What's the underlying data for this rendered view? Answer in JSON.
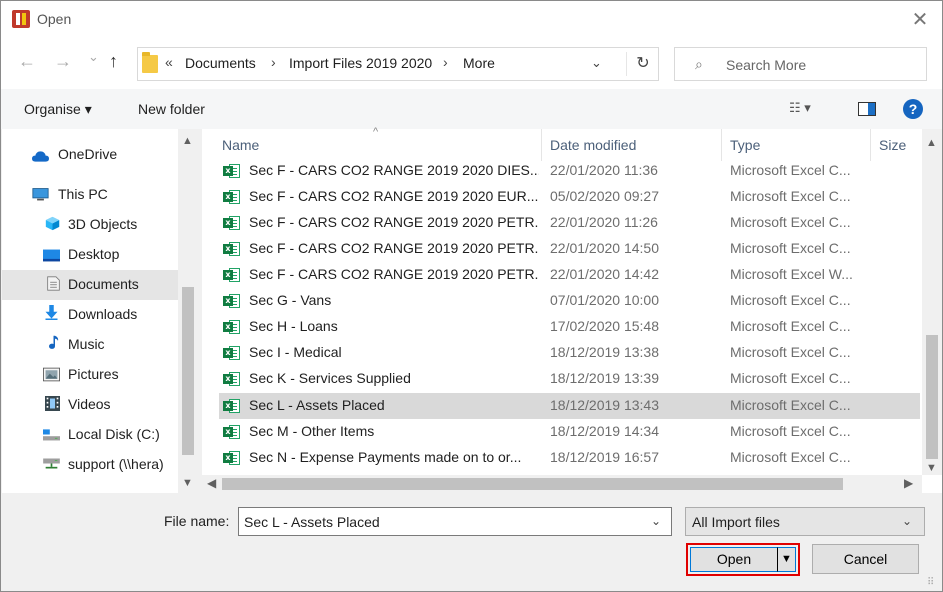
{
  "window": {
    "title": "Open",
    "close_glyph": "✕"
  },
  "nav": {
    "back_glyph": "←",
    "forward_glyph": "→",
    "recent_glyph": "⌄",
    "up_glyph": "↑",
    "breadcrumb": {
      "overflow": "«",
      "items": [
        "Documents",
        "Import Files 2019 2020",
        "More"
      ],
      "separator": "›"
    },
    "dropdown_glyph": "⌄",
    "refresh_glyph": "↻",
    "search_placeholder": "Search More",
    "search_glyph": "⌕"
  },
  "toolbar": {
    "organise_label": "Organise ▾",
    "new_folder_label": "New folder",
    "views_glyph": "☷ ▾",
    "help_glyph": "?"
  },
  "navpane": {
    "items": [
      {
        "label": "OneDrive",
        "icon": "cloud-icon"
      },
      {
        "label": "This PC",
        "icon": "computer-icon"
      },
      {
        "label": "3D Objects",
        "icon": "cube-icon"
      },
      {
        "label": "Desktop",
        "icon": "desktop-icon"
      },
      {
        "label": "Documents",
        "icon": "document-icon"
      },
      {
        "label": "Downloads",
        "icon": "download-icon"
      },
      {
        "label": "Music",
        "icon": "music-icon"
      },
      {
        "label": "Pictures",
        "icon": "pictures-icon"
      },
      {
        "label": "Videos",
        "icon": "video-icon"
      },
      {
        "label": "Local Disk (C:)",
        "icon": "drive-icon"
      },
      {
        "label": "support (\\\\hera)",
        "icon": "network-drive-icon"
      }
    ],
    "selected": "Documents"
  },
  "filelist": {
    "columns": [
      "Name",
      "Date modified",
      "Type",
      "Size"
    ],
    "rows": [
      {
        "name": "Sec F - CARS CO2 RANGE 2019 2020 DIES...",
        "date": "22/01/2020 11:36",
        "type": "Microsoft Excel C..."
      },
      {
        "name": "Sec F - CARS CO2 RANGE 2019 2020 EUR...",
        "date": "05/02/2020 09:27",
        "type": "Microsoft Excel C..."
      },
      {
        "name": "Sec F - CARS CO2 RANGE 2019 2020 PETR...",
        "date": "22/01/2020 11:26",
        "type": "Microsoft Excel C..."
      },
      {
        "name": "Sec F - CARS CO2 RANGE 2019 2020 PETR...",
        "date": "22/01/2020 14:50",
        "type": "Microsoft Excel C..."
      },
      {
        "name": "Sec F - CARS CO2 RANGE 2019 2020 PETR...",
        "date": "22/01/2020 14:42",
        "type": "Microsoft Excel W..."
      },
      {
        "name": "Sec G - Vans",
        "date": "07/01/2020 10:00",
        "type": "Microsoft Excel C..."
      },
      {
        "name": "Sec H - Loans",
        "date": "17/02/2020 15:48",
        "type": "Microsoft Excel C..."
      },
      {
        "name": "Sec I - Medical",
        "date": "18/12/2019 13:38",
        "type": "Microsoft Excel C..."
      },
      {
        "name": "Sec K - Services Supplied",
        "date": "18/12/2019 13:39",
        "type": "Microsoft Excel C..."
      },
      {
        "name": "Sec L - Assets Placed",
        "date": "18/12/2019 13:43",
        "type": "Microsoft Excel C..."
      },
      {
        "name": "Sec M - Other Items",
        "date": "18/12/2019 14:34",
        "type": "Microsoft Excel C..."
      },
      {
        "name": "Sec N - Expense Payments made on to or...",
        "date": "18/12/2019 16:57",
        "type": "Microsoft Excel C..."
      }
    ],
    "selected_row": "Sec L - Assets Placed"
  },
  "footer": {
    "file_name_label": "File name:",
    "file_name_value": "Sec L - Assets Placed",
    "filter_value": "All Import files",
    "open_label": "Open",
    "cancel_label": "Cancel",
    "highlight_color": "#e00000"
  }
}
